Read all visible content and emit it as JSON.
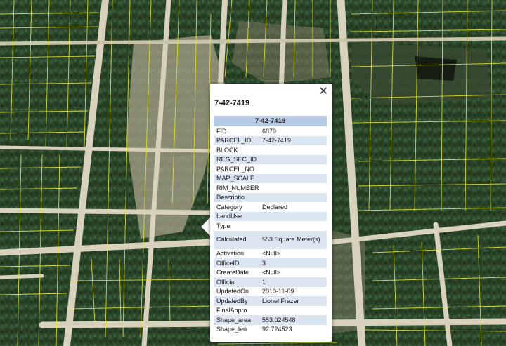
{
  "popup": {
    "title": "7-42-7419",
    "close_icon": "close-icon",
    "table_title": "7-42-7419",
    "header_color": "#b4c9e6",
    "alt_row_color": "#dce6f2",
    "rows": [
      {
        "key": "FID",
        "value": "6879"
      },
      {
        "key": "PARCEL_ID",
        "value": "7-42-7419"
      },
      {
        "key": "BLOCK",
        "value": ""
      },
      {
        "key": "REG_SEC_ID",
        "value": ""
      },
      {
        "key": "PARCEL_NO",
        "value": ""
      },
      {
        "key": "MAP_SCALE",
        "value": ""
      },
      {
        "key": "RIM_NUMBER",
        "value": ""
      },
      {
        "key": "Descriptio",
        "value": ""
      },
      {
        "key": "Category",
        "value": "Declared"
      },
      {
        "key": "LandUse",
        "value": ""
      },
      {
        "key": "Type",
        "value": ""
      },
      {
        "key": "Calculated",
        "value": "553 Square Meter(s)"
      },
      {
        "key": "Activation",
        "value": "<Null>"
      },
      {
        "key": "OfficeID",
        "value": "3"
      },
      {
        "key": "CreateDate",
        "value": "<Null>"
      },
      {
        "key": "Official",
        "value": "1"
      },
      {
        "key": "UpdatedOn",
        "value": "2010-11-09"
      },
      {
        "key": "UpdatedBy",
        "value": "Lionel Frazer"
      },
      {
        "key": "FinalAppro",
        "value": ""
      },
      {
        "key": "Shape_area",
        "value": "553.024548"
      },
      {
        "key": "Shape_len",
        "value": "92.724523"
      }
    ]
  },
  "map": {
    "basemap": "satellite-imagery",
    "parcel_line_color": "#e6e62a",
    "road_color": "#d9d3bf",
    "vegetation_color": "#2c4a2a"
  }
}
